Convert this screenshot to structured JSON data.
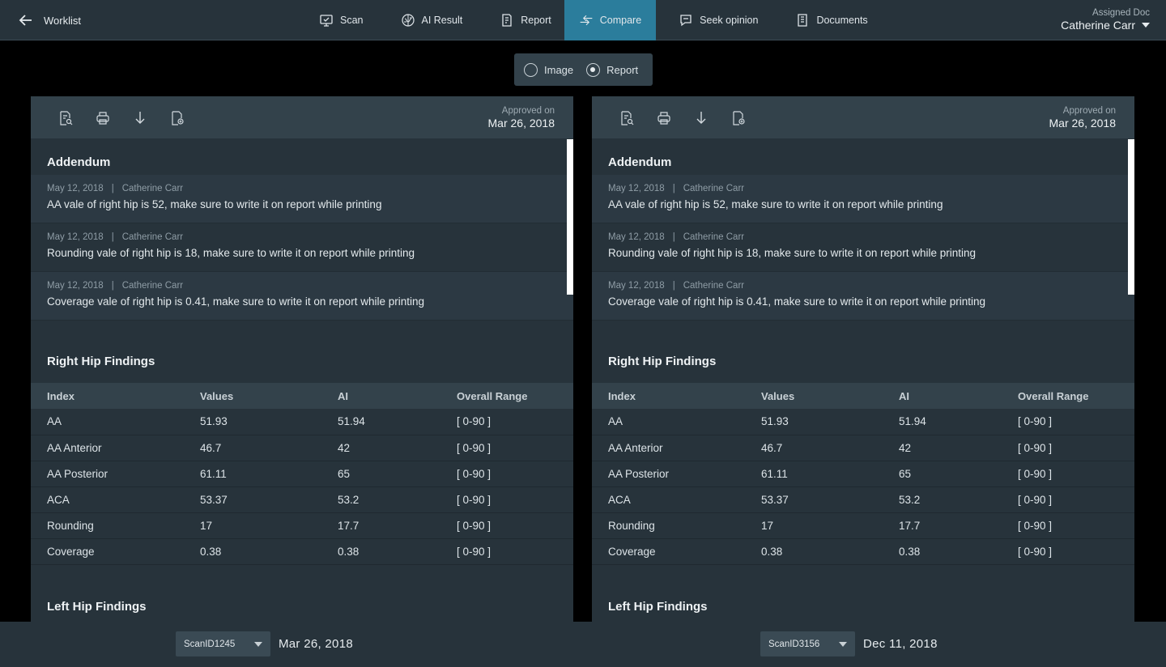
{
  "header": {
    "back_label": "Worklist",
    "tabs": [
      {
        "label": "Scan",
        "icon": "monitor-icon"
      },
      {
        "label": "AI Result",
        "icon": "brain-icon"
      },
      {
        "label": "Report",
        "icon": "report-icon"
      },
      {
        "label": "Compare",
        "icon": "compare-arrows-icon",
        "active": true
      },
      {
        "label": "Seek opinion",
        "icon": "chat-bubble-icon"
      },
      {
        "label": "Documents",
        "icon": "documents-icon"
      }
    ],
    "assigned_label": "Assigned Doc",
    "assigned_name": "Catherine Carr"
  },
  "view_toggle": {
    "options": [
      "Image",
      "Report"
    ],
    "selected": "Report"
  },
  "panels": [
    {
      "approved_label": "Approved on",
      "approved_date": "Mar 26, 2018",
      "addendum_title": "Addendum",
      "addendum": [
        {
          "date": "May 12, 2018",
          "author": "Catherine Carr",
          "text": "AA vale of right hip is 52, make sure to write it on report while printing"
        },
        {
          "date": "May 12, 2018",
          "author": "Catherine Carr",
          "text": "Rounding vale of right hip is 18, make sure to write it on report while printing"
        },
        {
          "date": "May 12, 2018",
          "author": "Catherine Carr",
          "text": "Coverage vale of right hip is 0.41, make sure to write it on report while printing"
        }
      ],
      "right_title": "Right Hip Findings",
      "columns": [
        "Index",
        "Values",
        "AI",
        "Overall Range"
      ],
      "rows": [
        [
          "AA",
          "51.93",
          "51.94",
          "[ 0-90 ]"
        ],
        [
          "AA Anterior",
          "46.7",
          "42",
          "[ 0-90 ]"
        ],
        [
          "AA Posterior",
          "61.11",
          "65",
          "[ 0-90 ]"
        ],
        [
          "ACA",
          "53.37",
          "53.2",
          "[ 0-90 ]"
        ],
        [
          "Rounding",
          "17",
          "17.7",
          "[ 0-90 ]"
        ],
        [
          "Coverage",
          "0.38",
          "0.38",
          "[ 0-90 ]"
        ]
      ],
      "left_title": "Left Hip Findings",
      "scan_id": "ScanID1245",
      "scan_date": "Mar 26, 2018"
    },
    {
      "approved_label": "Approved on",
      "approved_date": "Mar 26, 2018",
      "addendum_title": "Addendum",
      "addendum": [
        {
          "date": "May 12, 2018",
          "author": "Catherine Carr",
          "text": "AA vale of right hip is 52, make sure to write it on report while printing"
        },
        {
          "date": "May 12, 2018",
          "author": "Catherine Carr",
          "text": "Rounding vale of right hip is 18, make sure to write it on report while printing"
        },
        {
          "date": "May 12, 2018",
          "author": "Catherine Carr",
          "text": "Coverage vale of right hip is 0.41, make sure to write it on report while printing"
        }
      ],
      "right_title": "Right Hip Findings",
      "columns": [
        "Index",
        "Values",
        "AI",
        "Overall Range"
      ],
      "rows": [
        [
          "AA",
          "51.93",
          "51.94",
          "[ 0-90 ]"
        ],
        [
          "AA Anterior",
          "46.7",
          "42",
          "[ 0-90 ]"
        ],
        [
          "AA Posterior",
          "61.11",
          "65",
          "[ 0-90 ]"
        ],
        [
          "ACA",
          "53.37",
          "53.2",
          "[ 0-90 ]"
        ],
        [
          "Rounding",
          "17",
          "17.7",
          "[ 0-90 ]"
        ],
        [
          "Coverage",
          "0.38",
          "0.38",
          "[ 0-90 ]"
        ]
      ],
      "left_title": "Left Hip Findings",
      "scan_id": "ScanID3156",
      "scan_date": "Dec 11, 2018"
    }
  ],
  "colors": {
    "accent": "#2b7d9c",
    "background": "#000000",
    "panel": "#27333b",
    "toolbar": "#33424b"
  }
}
